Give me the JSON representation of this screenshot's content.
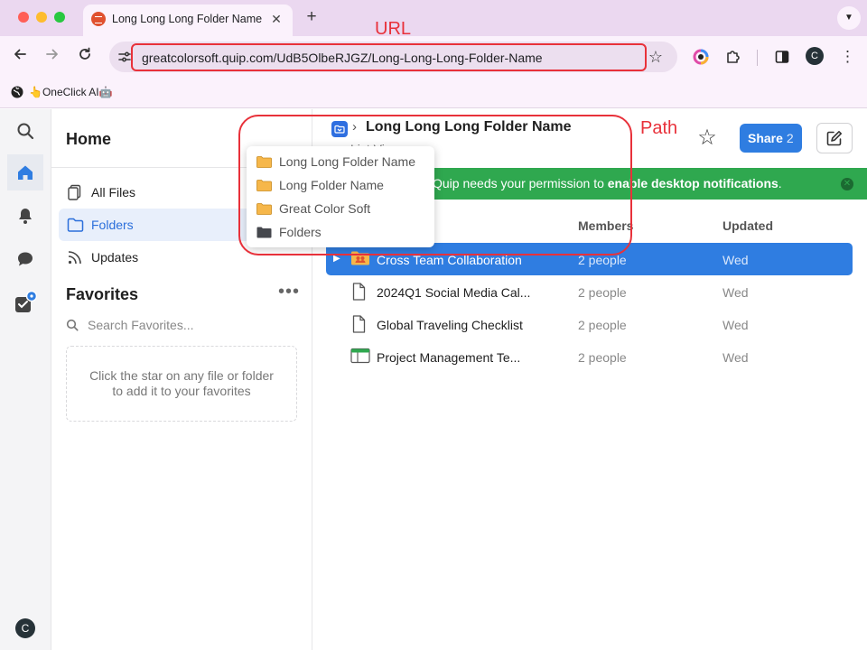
{
  "browser": {
    "tab_title": "Long Long Long Folder Name",
    "tab_close": "✕",
    "new_tab": "+",
    "url": "greatcolorsoft.quip.com/UdB5OlbeRJGZ/Long-Long-Long-Folder-Name",
    "profile_initial": "C",
    "bookmark": "👆OneClick AI🤖"
  },
  "annotations": {
    "url_label": "URL",
    "path_label": "Path",
    "color": "#e8313a"
  },
  "rail": {
    "avatar_initial": "C"
  },
  "sidebar": {
    "title": "Home",
    "items": [
      {
        "label": "All Files",
        "icon": "files-icon"
      },
      {
        "label": "Folders",
        "icon": "folder-icon",
        "active": true
      },
      {
        "label": "Updates",
        "icon": "updates-icon"
      }
    ],
    "favorites_title": "Favorites",
    "favorites_more": "•••",
    "search_placeholder": "Search Favorites...",
    "favorites_empty": "Click the star on any file or folder to add it to your favorites"
  },
  "main": {
    "breadcrumb_sep": "›",
    "title": "Long Long Long Folder Name",
    "view_link": "List View",
    "share_label": "Share",
    "share_count": "2",
    "notification_pre": "Quip needs your permission to ",
    "notification_bold": "enable desktop notifications",
    "notification_post": ".",
    "columns": {
      "members": "Members",
      "updated": "Updated"
    },
    "rows": [
      {
        "name": "Cross Team Collaboration",
        "members": "2 people",
        "updated": "Wed",
        "type": "shared-folder",
        "selected": true
      },
      {
        "name": "2024Q1 Social Media Cal...",
        "members": "2 people",
        "updated": "Wed",
        "type": "document"
      },
      {
        "name": "Global Traveling Checklist",
        "members": "2 people",
        "updated": "Wed",
        "type": "document"
      },
      {
        "name": "Project Management Te...",
        "members": "2 people",
        "updated": "Wed",
        "type": "spreadsheet"
      }
    ]
  },
  "path_dropdown": {
    "items": [
      {
        "label": "Long Long Folder Name",
        "color": "#f6b74a"
      },
      {
        "label": "Long Folder Name",
        "color": "#f6b74a"
      },
      {
        "label": "Great Color Soft",
        "color": "#f6b74a"
      },
      {
        "label": "Folders",
        "color": "#45474d"
      }
    ]
  },
  "colors": {
    "accent": "#2f7de1",
    "notification": "#2fa84f"
  }
}
